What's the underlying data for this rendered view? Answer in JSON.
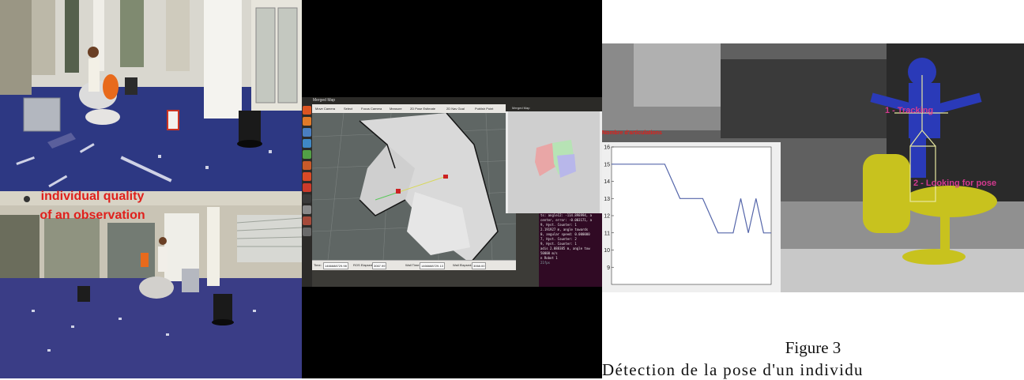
{
  "rviz": {
    "window_title": "Merged Map",
    "merged_panel_title": "Merged Map",
    "tools": [
      "Move Camera",
      "Select",
      "Focus Camera",
      "Measure",
      "2D Pose Estimate",
      "2D Nav Goal",
      "Publish Point"
    ],
    "time_bar": {
      "ros_time_label": "Time:",
      "ros_time": "1466688729.98",
      "ros_elapsed_label": "ROS Elapsed:",
      "ros_elapsed": "3067.99",
      "wall_time_label": "Wall Time:",
      "wall_time": "1466688729.13",
      "wall_elapsed_label": "Wall Elapsed:",
      "wall_elapsed": "3068.00",
      "experimental_label": "Experimental",
      "fps": "21fps"
    }
  },
  "terminal": {
    "lines": [
      "ts: angle12: -114.898994, a",
      "center, error: -0.003171, a",
      "9, Hyst. Counter: 1",
      "2.191927 m, angle towards",
      "0, angular speed: 0.000000",
      "7, Hyst. Counter: 2",
      "9, Hyst. Counter: 1",
      "adis 2.088385 m, angle tow",
      "50000 m/s",
      "",
      "n Robot 1"
    ]
  },
  "depth_view": {
    "tracking_label": "1 - Tracking",
    "pose_label": "2 - Looking for pose"
  },
  "chart_data": {
    "type": "line",
    "title": "",
    "ylabel": "Nombre d'articulations",
    "xlabel": "",
    "ylim": [
      8,
      16
    ],
    "y_ticks": [
      "16",
      "15",
      "14",
      "13",
      "12",
      "11",
      "10",
      "9"
    ],
    "x": [
      0,
      1,
      2,
      3,
      4,
      5,
      6,
      7,
      8,
      9,
      10,
      11,
      12,
      13,
      14,
      15,
      16,
      17,
      18,
      19,
      20,
      21
    ],
    "values": [
      15,
      15,
      15,
      15,
      15,
      15,
      15,
      15,
      14,
      13,
      13,
      13,
      13,
      12,
      11,
      11,
      11,
      13,
      11,
      13,
      11,
      11
    ],
    "overlay_text": [
      "individual quality",
      "of an observation"
    ],
    "line_color": "#5566aa"
  },
  "caption": {
    "title": "Figure 3",
    "text": "Détection de la pose d'un individu"
  }
}
